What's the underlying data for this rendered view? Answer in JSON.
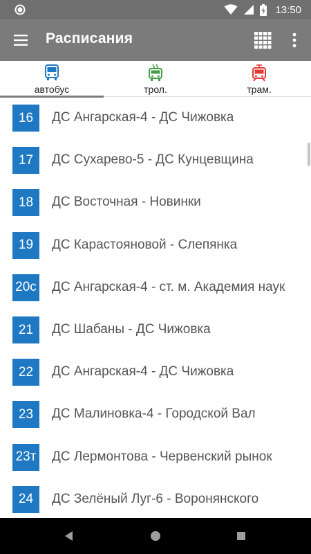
{
  "status_bar": {
    "time": "13:50"
  },
  "app_bar": {
    "title": "Расписания"
  },
  "tabs": [
    {
      "label": "автобус",
      "icon": "bus-icon",
      "color": "#1e78c2",
      "selected": true
    },
    {
      "label": "трол.",
      "icon": "trolleybus-icon",
      "color": "#43a047",
      "selected": false
    },
    {
      "label": "трам.",
      "icon": "tram-icon",
      "color": "#e53935",
      "selected": false
    }
  ],
  "colors": {
    "badge": "#1e78c2",
    "app_bar": "#7b7b7b",
    "status_bar": "#6f6f6f"
  },
  "routes": [
    {
      "number": "16",
      "name": "ДС Ангарская-4 - ДС Чижовка"
    },
    {
      "number": "17",
      "name": "ДС Сухарево-5 - ДС Кунцевщина"
    },
    {
      "number": "18",
      "name": "ДС Восточная - Новинки"
    },
    {
      "number": "19",
      "name": "ДС Карастояновой - Слепянка"
    },
    {
      "number": "20с",
      "name": "ДС Ангарская-4 - ст. м. Академия наук"
    },
    {
      "number": "21",
      "name": "ДС Шабаны - ДС Чижовка"
    },
    {
      "number": "22",
      "name": "ДС Ангарская-4 - ДС Чижовка"
    },
    {
      "number": "23",
      "name": "ДС Малиновка-4 - Городской Вал"
    },
    {
      "number": "23т",
      "name": "ДС Лермонтова - Червенский рынок"
    },
    {
      "number": "24",
      "name": "ДС Зелёный Луг-6 - Воронянского"
    }
  ]
}
